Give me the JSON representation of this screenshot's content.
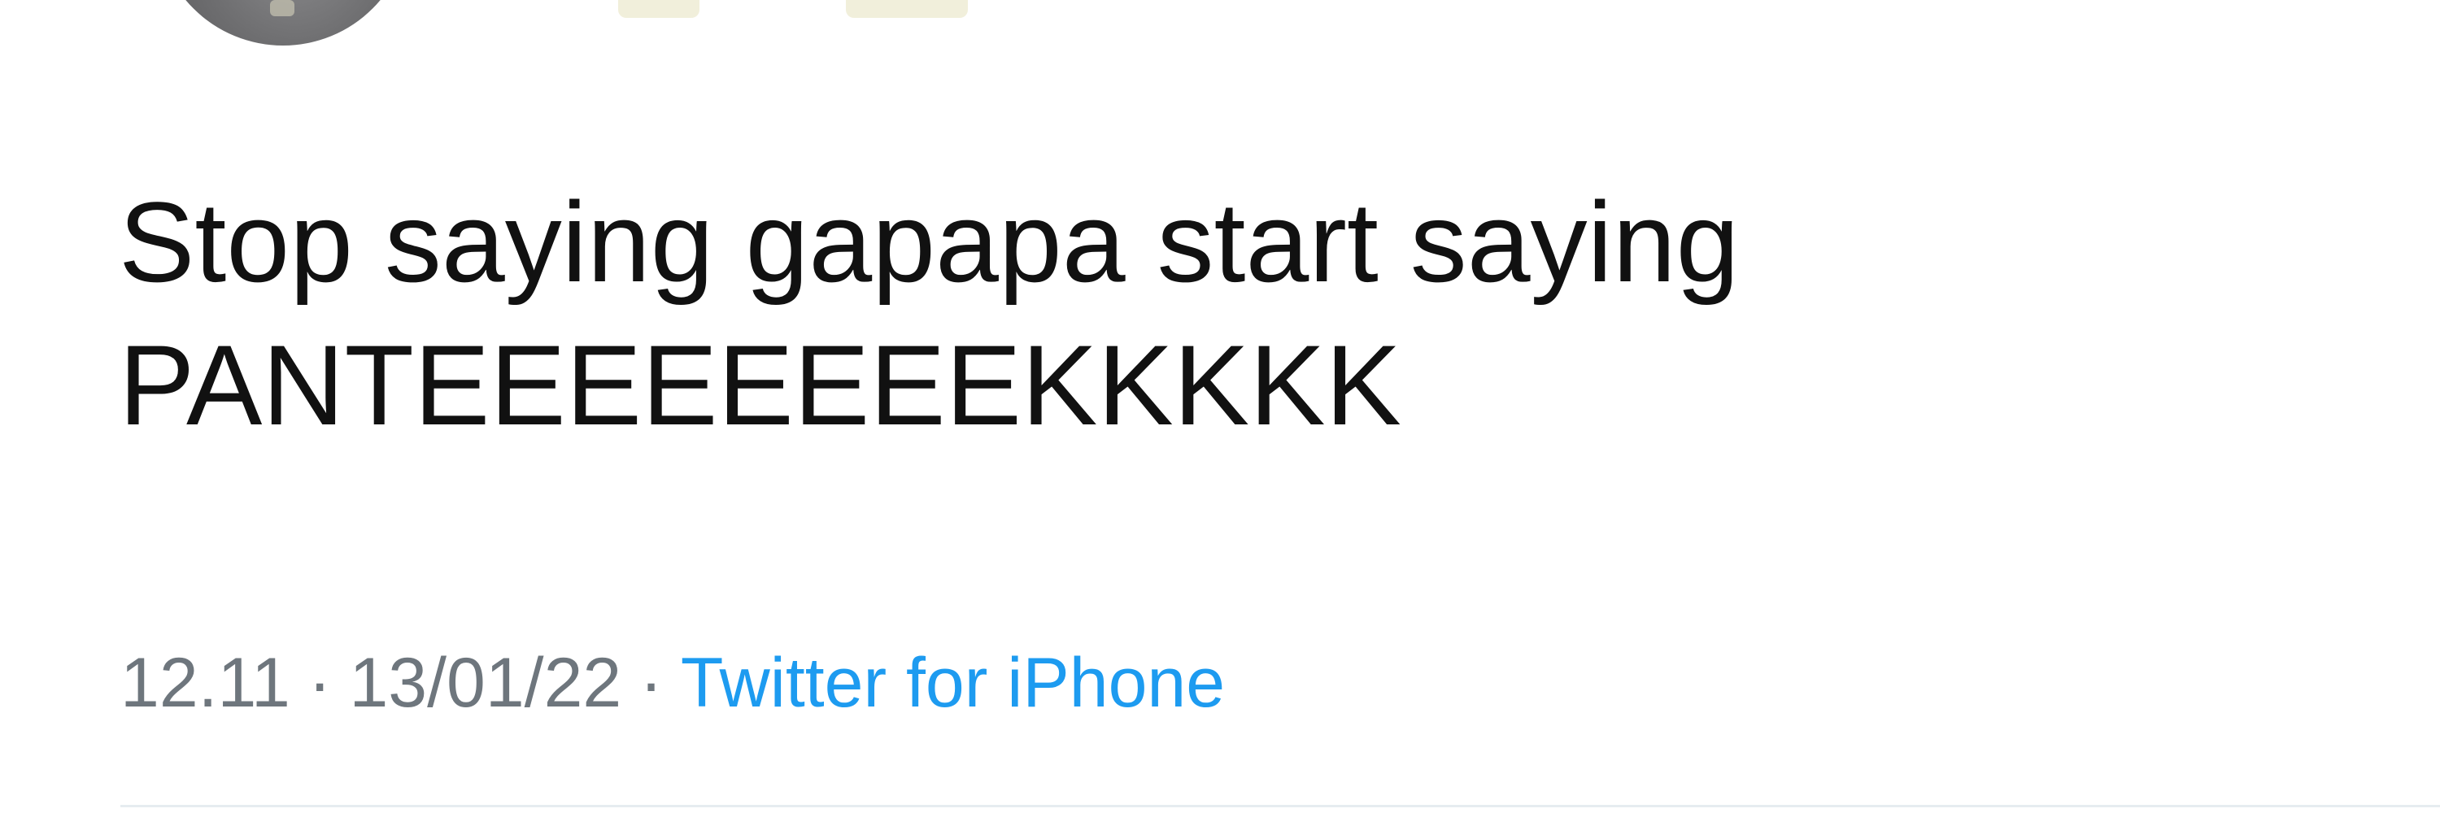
{
  "tweet": {
    "text_lines": [
      "Stop saying gapapa start saying",
      "PANTEEEEEEEEKKKKK"
    ],
    "time": "12.11",
    "date": "13/01/22",
    "separator": "·",
    "source": "Twitter for iPhone"
  },
  "colors": {
    "text": "#111111",
    "meta": "#6e767d",
    "source_link": "#1d9bf0"
  }
}
